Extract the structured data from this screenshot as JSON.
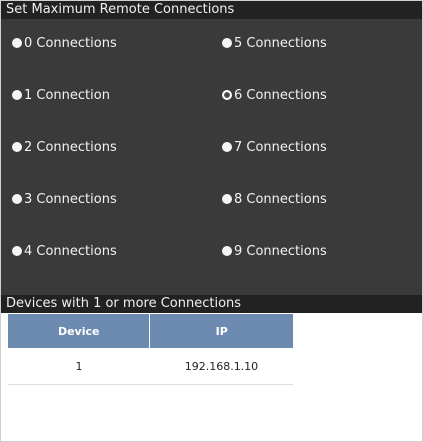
{
  "connections_section": {
    "title": "Set Maximum Remote Connections",
    "options": [
      {
        "label": "0 Connections",
        "selected": false
      },
      {
        "label": "1 Connection",
        "selected": false
      },
      {
        "label": "2 Connections",
        "selected": false
      },
      {
        "label": "3 Connections",
        "selected": false
      },
      {
        "label": "4 Connections",
        "selected": false
      },
      {
        "label": "5 Connections",
        "selected": false
      },
      {
        "label": "6 Connections",
        "selected": true
      },
      {
        "label": "7 Connections",
        "selected": false
      },
      {
        "label": "8 Connections",
        "selected": false
      },
      {
        "label": "9 Connections",
        "selected": false
      }
    ]
  },
  "devices_section": {
    "title": "Devices with 1 or more Connections",
    "columns": [
      "Device",
      "IP"
    ],
    "rows": [
      {
        "device": "1",
        "ip": "192.168.1.10"
      }
    ]
  },
  "colors": {
    "panel_background": "#3a3a3a",
    "header_background": "#222222",
    "table_header": "#6d8bb0"
  }
}
